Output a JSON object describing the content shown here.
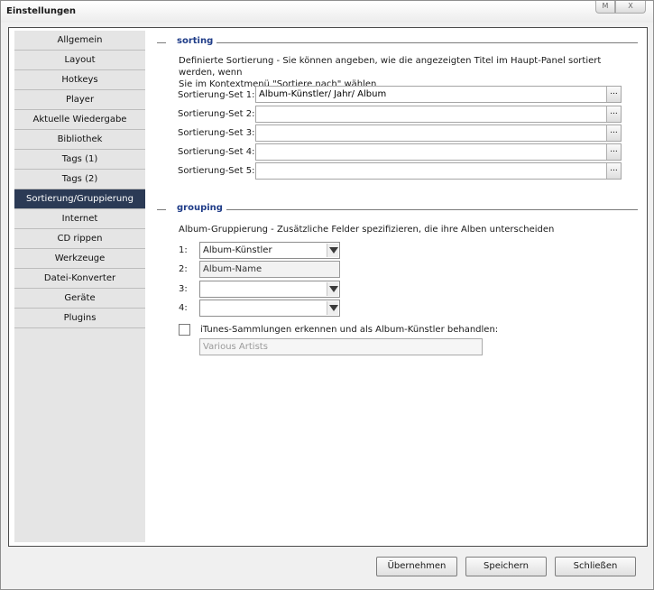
{
  "window": {
    "title": "Einstellungen",
    "buttons": [
      "M",
      "X"
    ]
  },
  "sidebar": {
    "items": [
      {
        "label": "Allgemein"
      },
      {
        "label": "Layout"
      },
      {
        "label": "Hotkeys"
      },
      {
        "label": "Player"
      },
      {
        "label": "Aktuelle Wiedergabe"
      },
      {
        "label": "Bibliothek"
      },
      {
        "label": "Tags (1)"
      },
      {
        "label": "Tags (2)"
      },
      {
        "label": "Sortierung/Gruppierung",
        "active": true
      },
      {
        "label": "Internet"
      },
      {
        "label": "CD rippen"
      },
      {
        "label": "Werkzeuge"
      },
      {
        "label": "Datei-Konverter"
      },
      {
        "label": "Geräte"
      },
      {
        "label": "Plugins"
      }
    ]
  },
  "sorting": {
    "heading": "sorting",
    "description_line1": "Definierte Sortierung - Sie können angeben, wie die angezeigten Titel im Haupt-Panel sortiert werden, wenn",
    "description_line2": "Sie im Kontextmenü \"Sortiere nach\" wählen",
    "button_label": "...",
    "sets": [
      {
        "label": "Sortierung-Set 1:",
        "value": "Album-Künstler/ Jahr/ Album"
      },
      {
        "label": "Sortierung-Set 2:",
        "value": ""
      },
      {
        "label": "Sortierung-Set 3:",
        "value": ""
      },
      {
        "label": "Sortierung-Set 4:",
        "value": ""
      },
      {
        "label": "Sortierung-Set 5:",
        "value": ""
      }
    ]
  },
  "grouping": {
    "heading": "grouping",
    "description": "Album-Gruppierung - Zusätzliche Felder spezifizieren, die ihre Alben unterscheiden",
    "fields": [
      {
        "num": "1:",
        "value": "Album-Künstler"
      },
      {
        "num": "2:",
        "value": "Album-Name"
      },
      {
        "num": "3:",
        "value": ""
      },
      {
        "num": "4:",
        "value": ""
      }
    ],
    "itunes_checkbox_label": "iTunes-Sammlungen erkennen und als Album-Künstler behandlen:",
    "itunes_checked": false,
    "itunes_placeholder": "Various Artists"
  },
  "footer": {
    "apply": "Übernehmen",
    "save": "Speichern",
    "close": "Schließen"
  },
  "colors": {
    "accent_heading": "#1f3c88",
    "active_nav_bg": "#2b3a55"
  }
}
